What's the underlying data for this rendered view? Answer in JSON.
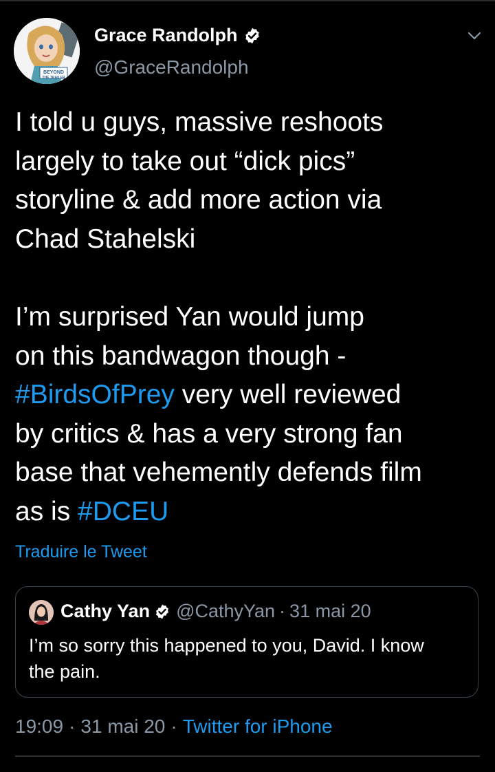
{
  "author": {
    "name": "Grace Randolph",
    "handle": "@GraceRandolph",
    "avatar_badge_text": "BEYOND THE TRAILER"
  },
  "tweet": {
    "paragraph1": [
      "I told u guys, massive reshoots",
      "largely to take out “dick pics”",
      "storyline & add more action via",
      "Chad Stahelski"
    ],
    "paragraph2": {
      "line1": "I’m surprised Yan would jump",
      "line2": "on this bandwagon though -",
      "line3_hashtag": "#BirdsOfPrey",
      "line3_rest": " very well reviewed",
      "line4": "by critics & has a very strong fan",
      "line5": "base that vehemently defends film",
      "line6_text": "as is ",
      "line6_hashtag": "#DCEU"
    },
    "translate_label": "Traduire le Tweet"
  },
  "quoted_tweet": {
    "name": "Cathy Yan",
    "handle": "@CathyYan",
    "separator": "·",
    "date": "31 mai 20",
    "text_line1": "I’m so sorry this happened to you, David. I know",
    "text_line2": "the pain."
  },
  "meta": {
    "time": "19:09",
    "separator": "·",
    "date": "31 mai 20",
    "source": "Twitter for iPhone"
  },
  "icons": {
    "verified": "verified-badge-icon",
    "menu": "chevron-down-icon"
  },
  "colors": {
    "background": "#000000",
    "link": "#1d9bf0",
    "secondary_text": "#8b98a5",
    "border": "#38444d"
  }
}
